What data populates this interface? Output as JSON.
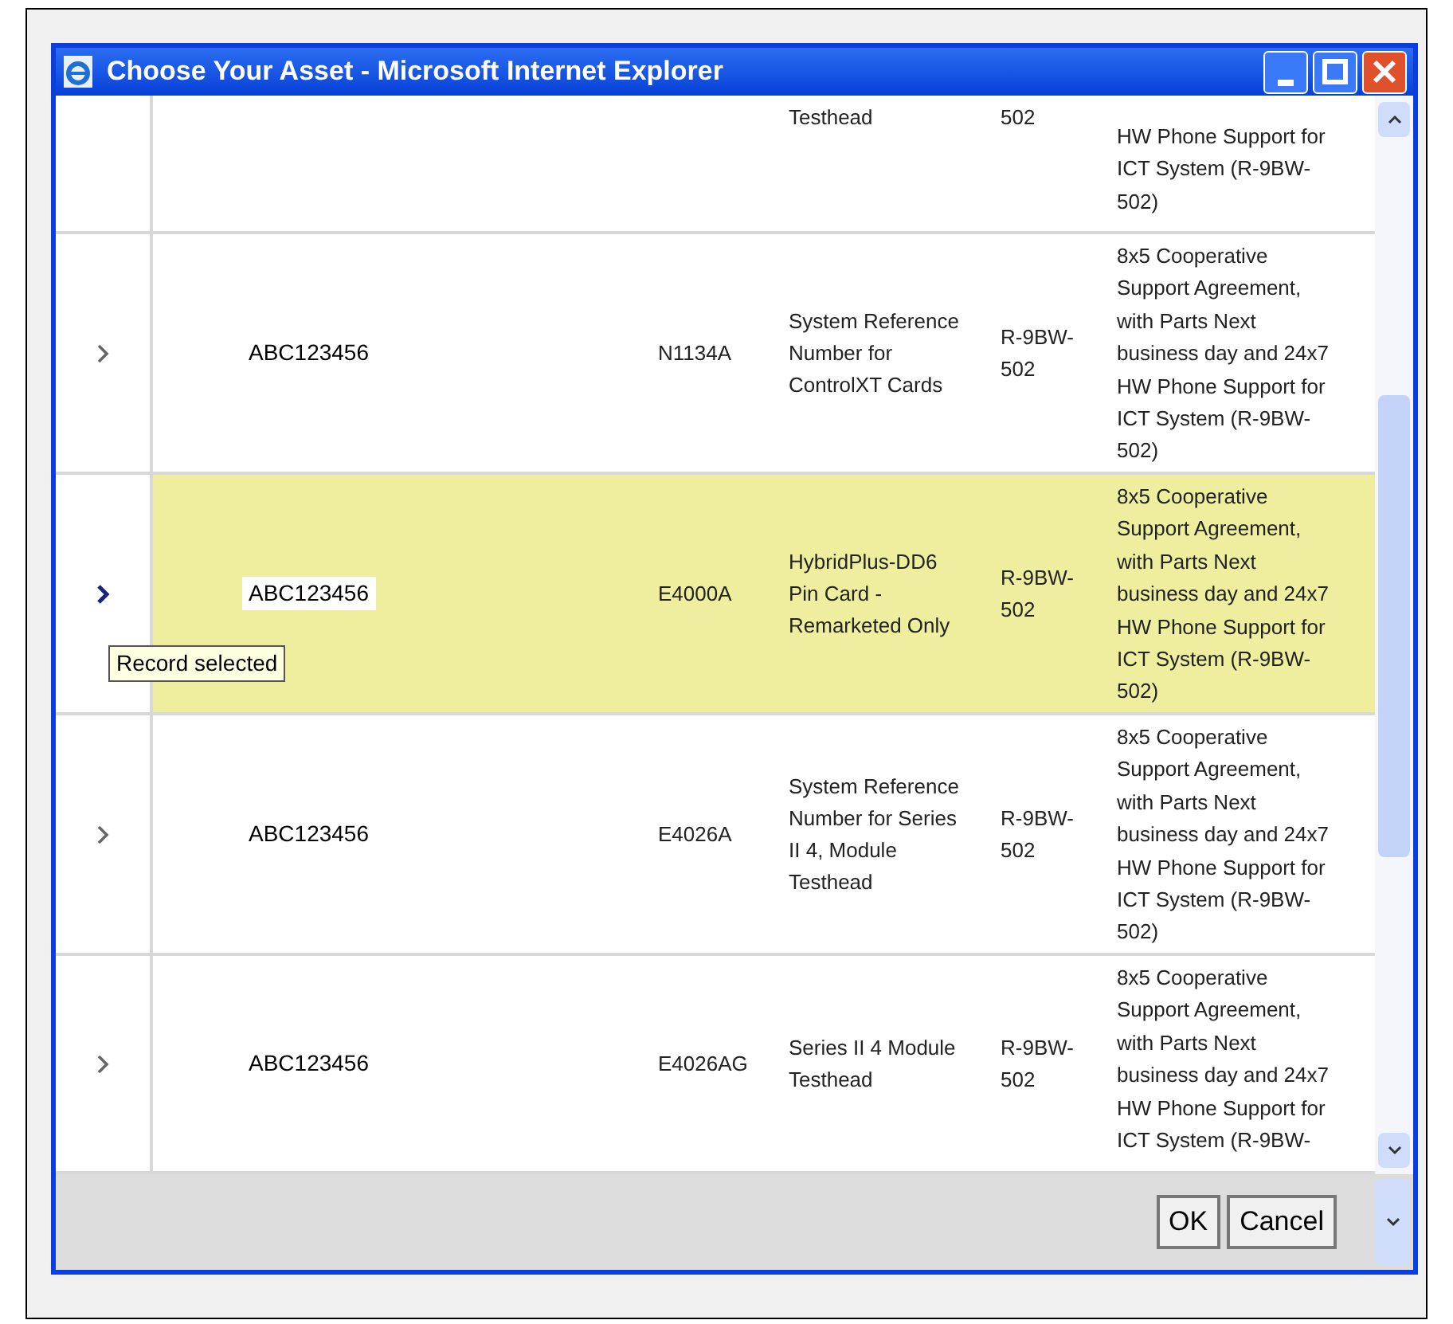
{
  "window": {
    "title": "Choose Your Asset - Microsoft Internet Explorer"
  },
  "rows": [
    {
      "selected": false,
      "description": "Testhead",
      "location": "502",
      "support": "HW Phone Support for\nICT System (R-9BW-\n502)"
    },
    {
      "selected": false,
      "asset": "ABC123456",
      "part": "N1134A",
      "description": "System Reference\nNumber for\nControlXT Cards",
      "location": "R-9BW-\n502",
      "support": "8x5 Cooperative\nSupport Agreement,\nwith Parts Next\nbusiness day and 24x7\nHW Phone Support for\nICT System (R-9BW-\n502)"
    },
    {
      "selected": true,
      "asset": "ABC123456",
      "part": "E4000A",
      "description": "HybridPlus-DD6\nPin Card -\nRemarketed Only",
      "location": "R-9BW-\n502",
      "support": "8x5 Cooperative\nSupport Agreement,\nwith Parts Next\nbusiness day and 24x7\nHW Phone Support for\nICT System (R-9BW-\n502)",
      "tooltip": "Record selected"
    },
    {
      "selected": false,
      "asset": "ABC123456",
      "part": "E4026A",
      "description": "System Reference\nNumber for Series\nII 4, Module\nTesthead",
      "location": "R-9BW-\n502",
      "support": "8x5 Cooperative\nSupport Agreement,\nwith Parts Next\nbusiness day and 24x7\nHW Phone Support for\nICT System (R-9BW-\n502)"
    },
    {
      "selected": false,
      "asset": "ABC123456",
      "part": "E4026AG",
      "description": "Series II 4 Module\nTesthead",
      "location": "R-9BW-\n502",
      "support": "8x5 Cooperative\nSupport Agreement,\nwith Parts Next\nbusiness day and 24x7\nHW Phone Support for\nICT System (R-9BW-"
    }
  ],
  "buttons": [
    "OK",
    "Cancel"
  ]
}
